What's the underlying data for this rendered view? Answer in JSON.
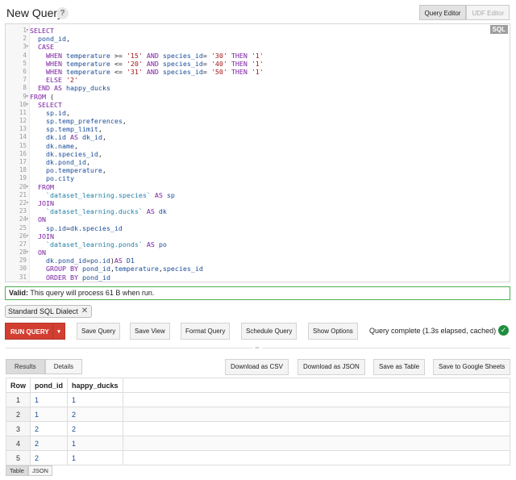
{
  "header": {
    "title": "New Query",
    "help_label": "?",
    "tabs": [
      {
        "label": "Query Editor",
        "active": true
      },
      {
        "label": "UDF Editor",
        "active": false
      }
    ]
  },
  "editor": {
    "language_badge": "SQL",
    "lines": [
      {
        "n": "1",
        "fold": "▾",
        "text": "SELECT"
      },
      {
        "n": "2",
        "fold": "",
        "text": "  pond_id,"
      },
      {
        "n": "3",
        "fold": "▾",
        "text": "  CASE"
      },
      {
        "n": "4",
        "fold": "",
        "text": "    WHEN temperature >= '15' AND species_id= '30' THEN '1'"
      },
      {
        "n": "5",
        "fold": "",
        "text": "    WHEN temperature <= '20' AND species_id= '40' THEN '1'"
      },
      {
        "n": "6",
        "fold": "",
        "text": "    WHEN temperature <= '31' AND species_id= '50' THEN '1'"
      },
      {
        "n": "7",
        "fold": "",
        "text": "    ELSE '2'"
      },
      {
        "n": "8",
        "fold": "",
        "text": "  END AS happy_ducks"
      },
      {
        "n": "9",
        "fold": "▾",
        "text": "FROM ("
      },
      {
        "n": "10",
        "fold": "▾",
        "text": "  SELECT"
      },
      {
        "n": "11",
        "fold": "",
        "text": "    sp.id,"
      },
      {
        "n": "12",
        "fold": "",
        "text": "    sp.temp_preferences,"
      },
      {
        "n": "13",
        "fold": "",
        "text": "    sp.temp_limit,"
      },
      {
        "n": "14",
        "fold": "",
        "text": "    dk.id AS dk_id,"
      },
      {
        "n": "15",
        "fold": "",
        "text": "    dk.name,"
      },
      {
        "n": "16",
        "fold": "",
        "text": "    dk.species_id,"
      },
      {
        "n": "17",
        "fold": "",
        "text": "    dk.pond_id,"
      },
      {
        "n": "18",
        "fold": "",
        "text": "    po.temperature,"
      },
      {
        "n": "19",
        "fold": "",
        "text": "    po.city"
      },
      {
        "n": "20",
        "fold": "▾",
        "text": "  FROM"
      },
      {
        "n": "21",
        "fold": "",
        "text": "    `dataset_learning.species` AS sp"
      },
      {
        "n": "22",
        "fold": "▾",
        "text": "  JOIN"
      },
      {
        "n": "23",
        "fold": "",
        "text": "    `dataset_learning.ducks` AS dk"
      },
      {
        "n": "24",
        "fold": "▾",
        "text": "  ON"
      },
      {
        "n": "25",
        "fold": "",
        "text": "    sp.id=dk.species_id"
      },
      {
        "n": "26",
        "fold": "▾",
        "text": "  JOIN"
      },
      {
        "n": "27",
        "fold": "",
        "text": "    `dataset_learning.ponds` AS po"
      },
      {
        "n": "28",
        "fold": "▾",
        "text": "  ON"
      },
      {
        "n": "29",
        "fold": "",
        "text": "    dk.pond_id=po.id)AS D1"
      },
      {
        "n": "30",
        "fold": "",
        "text": "    GROUP BY pond_id,temperature,species_id"
      },
      {
        "n": "31",
        "fold": "",
        "text": "    ORDER BY pond_id"
      }
    ]
  },
  "validation": {
    "label": "Valid:",
    "message": "This query will process 61 B when run."
  },
  "dialect": {
    "label": "Standard SQL Dialect",
    "remove_icon": "close-icon"
  },
  "toolbar": {
    "run_label": "RUN QUERY",
    "run_caret": "▾",
    "buttons": [
      "Save Query",
      "Save View",
      "Format Query",
      "Schedule Query",
      "Show Options"
    ],
    "status": "Query complete (1.3s elapsed, cached)",
    "status_icon": "check-circle-icon",
    "status_color": "#1e8e3e"
  },
  "results": {
    "tabs": [
      {
        "label": "Results",
        "active": true
      },
      {
        "label": "Details",
        "active": false
      }
    ],
    "actions": [
      "Download as CSV",
      "Download as JSON",
      "Save as Table",
      "Save to Google Sheets"
    ],
    "columns": [
      "Row",
      "pond_id",
      "happy_ducks"
    ],
    "rows": [
      [
        "1",
        "1",
        "1"
      ],
      [
        "2",
        "1",
        "2"
      ],
      [
        "3",
        "2",
        "2"
      ],
      [
        "4",
        "2",
        "1"
      ],
      [
        "5",
        "2",
        "1"
      ]
    ]
  },
  "view_tabs": [
    {
      "label": "Table",
      "active": true
    },
    {
      "label": "JSON",
      "active": false
    }
  ],
  "colors": {
    "run_button": "#d23f31",
    "valid_border": "#4caf50",
    "keyword": "#7a1fa2",
    "identifier": "#1a4d99",
    "string": "#a31515"
  }
}
